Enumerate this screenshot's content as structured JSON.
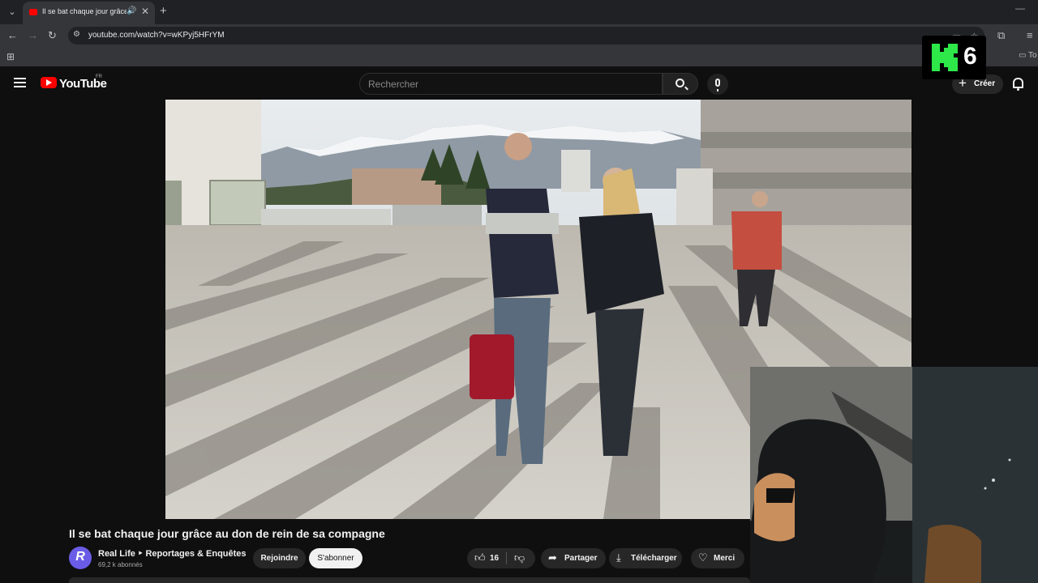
{
  "browser": {
    "tab_title": "Il se bat chaque jour grâce au don de rein de sa compagne",
    "url": "youtube.com/watch?v=wKPyj5HFrYM",
    "bookmark_folder_label": "To"
  },
  "youtube": {
    "wordmark": "YouTube",
    "country_code": "FR",
    "search_placeholder": "Rechercher",
    "create_label": "Créer"
  },
  "overlay": {
    "badge_number": "6",
    "badge_color": "#2ee84a"
  },
  "video": {
    "title": "Il se bat chaque jour grâce au don de rein de sa compagne",
    "channel": {
      "name": "Real Life ‣ Reportages & Enquêtes",
      "avatar_letter": "R",
      "subscribers": "69,2 k abonnés"
    },
    "join_label": "Rejoindre",
    "subscribe_label": "S'abonner",
    "like_count": "16",
    "share_label": "Partager",
    "download_label": "Télécharger",
    "thanks_label": "Merci"
  },
  "colors": {
    "brand_red": "#ff0000",
    "bg": "#0f0f0f",
    "pill": "#272727"
  }
}
